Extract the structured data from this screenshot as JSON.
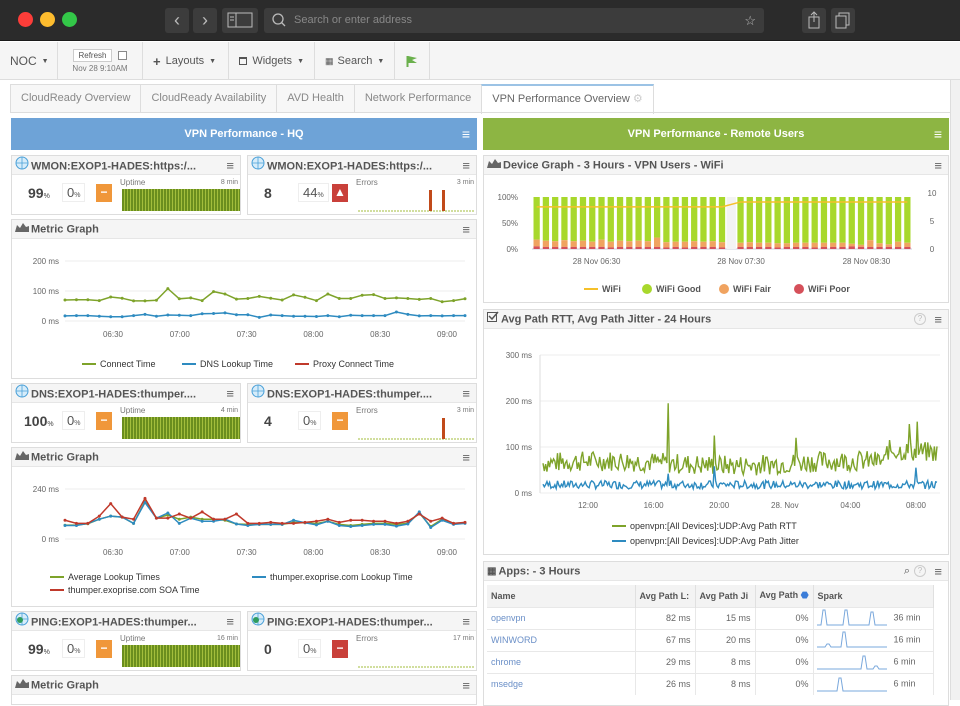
{
  "browser": {
    "address_placeholder": "Search or enter address",
    "icons": [
      "back-icon",
      "forward-icon",
      "sidebar-icon",
      "search-icon",
      "star-icon",
      "share-icon",
      "tabs-icon"
    ]
  },
  "toolbar": {
    "noc": "NOC",
    "refresh": "Refresh",
    "refresh_time": "Nov 28 9:10AM",
    "layouts": "Layouts",
    "widgets": "Widgets",
    "search": "Search"
  },
  "tabs": [
    "CloudReady Overview",
    "CloudReady Availability",
    "AVD Health",
    "Network Performance",
    "VPN Performance Overview"
  ],
  "left": {
    "header": "VPN Performance - HQ",
    "header_color": "#6ea3d7",
    "widgets": [
      {
        "title": "WMON:EXOP1-HADES:https:/...",
        "value": "99",
        "unit": "%",
        "pct": "0",
        "status": "minus",
        "status_color": "#f0973a",
        "spark_label": "Uptime",
        "spark_time": "8 min"
      },
      {
        "title": "WMON:EXOP1-HADES:https:/...",
        "value": "8",
        "unit": "",
        "pct": "44",
        "status": "up",
        "status_color": "#c9403a",
        "spark_label": "Errors",
        "spark_time": "3 min"
      },
      {
        "title": "DNS:EXOP1-HADES:thumper....",
        "value": "100",
        "unit": "%",
        "pct": "0",
        "status": "minus",
        "status_color": "#f0973a",
        "spark_label": "Uptime",
        "spark_time": "4 min"
      },
      {
        "title": "DNS:EXOP1-HADES:thumper....",
        "value": "4",
        "unit": "",
        "pct": "0",
        "status": "minus",
        "status_color": "#f0973a",
        "spark_label": "Errors",
        "spark_time": "3 min"
      },
      {
        "title": "PING:EXOP1-HADES:thumper...",
        "value": "99",
        "unit": "%",
        "pct": "0",
        "status": "minus",
        "status_color": "#f0973a",
        "spark_label": "Uptime",
        "spark_time": "16 min"
      },
      {
        "title": "PING:EXOP1-HADES:thumper...",
        "value": "0",
        "unit": "",
        "pct": "0",
        "status": "minus",
        "status_color": "#c9403a",
        "spark_label": "Errors",
        "spark_time": "17 min"
      }
    ],
    "metric1_title": "Metric Graph",
    "metric2_title": "Metric Graph",
    "metric3_title": "Metric Graph"
  },
  "right": {
    "header": "VPN Performance - Remote Users",
    "header_color": "#8db543",
    "device_title": "Device Graph - 3 Hours - VPN Users - WiFi",
    "rtt_title": "Avg Path RTT, Avg Path Jitter - 24 Hours",
    "apps": {
      "title": "Apps: - 3 Hours",
      "columns": [
        "Name",
        "Avg Path L:",
        "Avg Path Ji",
        "Avg Path ",
        "Spark"
      ],
      "rows": [
        {
          "name": "openvpn",
          "lat": "82 ms",
          "jit": "15 ms",
          "loss": "0%",
          "spark": "36 min"
        },
        {
          "name": "WINWORD",
          "lat": "67 ms",
          "jit": "20 ms",
          "loss": "0%",
          "spark": "16 min"
        },
        {
          "name": "chrome",
          "lat": "29 ms",
          "jit": "8 ms",
          "loss": "0%",
          "spark": "6 min"
        },
        {
          "name": "msedge",
          "lat": "26 ms",
          "jit": "8 ms",
          "loss": "0%",
          "spark": "6 min"
        }
      ]
    }
  },
  "chart_data": [
    {
      "type": "line",
      "title": "Metric Graph",
      "ylabel": "",
      "ylim": [
        0,
        200
      ],
      "yticks": [
        "0 ms",
        "100 ms",
        "200 ms"
      ],
      "xticks": [
        "06:30",
        "07:00",
        "07:30",
        "08:00",
        "08:30",
        "09:00"
      ],
      "series": [
        {
          "name": "Connect Time",
          "color": "#7ea32a",
          "values": [
            70,
            71,
            71,
            68,
            80,
            76,
            67,
            67,
            69,
            108,
            74,
            77,
            68,
            98,
            90,
            73,
            75,
            82,
            76,
            70,
            87,
            79,
            68,
            90,
            75,
            75,
            86,
            88,
            75,
            77,
            75,
            72,
            75,
            64,
            68,
            74
          ]
        },
        {
          "name": "DNS Lookup Time",
          "color": "#2e8bc0",
          "values": [
            17,
            18,
            18,
            16,
            14,
            14,
            18,
            22,
            16,
            20,
            19,
            18,
            24,
            25,
            27,
            21,
            21,
            12,
            20,
            18,
            16,
            16,
            15,
            18,
            14,
            19,
            18,
            18,
            18,
            30,
            22,
            17,
            18,
            17,
            18,
            18
          ]
        },
        {
          "name": "Proxy Connect Time",
          "color": "#c0392b",
          "values": []
        }
      ]
    },
    {
      "type": "line",
      "title": "Metric Graph",
      "ylim": [
        0,
        240
      ],
      "yticks": [
        "0 ms",
        "240 ms"
      ],
      "xticks": [
        "06:30",
        "07:00",
        "07:30",
        "08:00",
        "08:30",
        "09:00"
      ],
      "series": [
        {
          "name": "Average Lookup Times",
          "color": "#7ea32a",
          "values": [
            66,
            67,
            73,
            95,
            110,
            105,
            75,
            180,
            100,
            115,
            95,
            105,
            95,
            95,
            90,
            72,
            70,
            70,
            70,
            70,
            80,
            78,
            74,
            85,
            70,
            65,
            70,
            75,
            75,
            70,
            75,
            125,
            60,
            95,
            75,
            78
          ]
        },
        {
          "name": "thumper.exoprise.com Lookup Time",
          "color": "#2e8bc0",
          "values": [
            65,
            65,
            75,
            95,
            110,
            105,
            75,
            175,
            100,
            125,
            75,
            100,
            85,
            85,
            95,
            72,
            65,
            70,
            70,
            70,
            90,
            78,
            68,
            85,
            65,
            60,
            65,
            70,
            70,
            62,
            72,
            130,
            55,
            90,
            70,
            75
          ]
        },
        {
          "name": "thumper.exoprise.com SOA Time",
          "color": "#c0392b",
          "values": [
            90,
            75,
            75,
            110,
            170,
            105,
            95,
            195,
            100,
            100,
            120,
            100,
            130,
            95,
            95,
            120,
            75,
            75,
            80,
            75,
            75,
            80,
            85,
            95,
            80,
            90,
            90,
            85,
            85,
            75,
            85,
            120,
            85,
            100,
            75,
            80
          ]
        }
      ]
    },
    {
      "type": "bar",
      "title": "Device Graph - 3 Hours - VPN Users - WiFi",
      "xticks": [
        "28 Nov 06:30",
        "28 Nov 07:30",
        "28 Nov 08:30"
      ],
      "yticks_left": [
        "0%",
        "50%",
        "100%"
      ],
      "yticks_right": [
        "0",
        "5",
        "10"
      ],
      "series": [
        {
          "name": "WiFi",
          "color": "#f5c02a",
          "type": "line"
        },
        {
          "name": "WiFi Good",
          "color": "#a8d82c"
        },
        {
          "name": "WiFi Fair",
          "color": "#f0a360"
        },
        {
          "name": "WiFi Poor",
          "color": "#d5505a"
        }
      ],
      "wifi_count": [
        8.5,
        8.5,
        8.5,
        8.5,
        8.5,
        8.5,
        8.5,
        8.5,
        8.5,
        8.5,
        8.5,
        8.5,
        8.5,
        8.5,
        8.5,
        8.5,
        8.5,
        8.5,
        8.5,
        8.5,
        8.5,
        null,
        9.5,
        9.5,
        9.5,
        9.5,
        9.5,
        9.5,
        9.5,
        9.5,
        9.5,
        9.5,
        9.5,
        9.5,
        9.5,
        9.5,
        9.5,
        9.5,
        9.5,
        9.5,
        9.5
      ],
      "fair_pct": [
        18,
        16,
        15,
        17,
        15,
        16,
        14,
        18,
        14,
        16,
        15,
        16,
        15,
        22,
        13,
        14,
        14,
        15,
        14,
        15,
        13,
        null,
        12,
        13,
        12,
        12,
        11,
        11,
        12,
        12,
        12,
        12,
        12,
        12,
        10,
        8,
        17,
        11,
        9,
        14,
        12
      ],
      "poor_pct": [
        5,
        4,
        4,
        4,
        4,
        4,
        4,
        4,
        3,
        4,
        4,
        4,
        4,
        4,
        3,
        4,
        3,
        4,
        4,
        4,
        3,
        null,
        4,
        4,
        4,
        4,
        3,
        4,
        4,
        4,
        3,
        4,
        4,
        4,
        5,
        4,
        4,
        4,
        4,
        4,
        4
      ]
    },
    {
      "type": "line",
      "title": "Avg Path RTT, Avg Path Jitter - 24 Hours",
      "ylim": [
        0,
        300
      ],
      "yticks": [
        "0 ms",
        "100 ms",
        "200 ms",
        "300 ms"
      ],
      "xticks": [
        "12:00",
        "16:00",
        "20:00",
        "28. Nov",
        "04:00",
        "08:00"
      ],
      "series": [
        {
          "name": "openvpn:[All Devices]:UDP:Avg Path RTT",
          "color": "#7ea32a"
        },
        {
          "name": "openvpn:[All Devices]:UDP:Avg Path Jitter",
          "color": "#2e8bc0"
        }
      ]
    }
  ]
}
